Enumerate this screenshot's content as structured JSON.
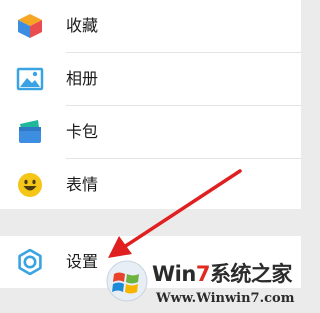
{
  "menu": {
    "items": [
      {
        "label": "收藏",
        "icon": "favorites-cube-icon"
      },
      {
        "label": "相册",
        "icon": "album-picture-icon"
      },
      {
        "label": "卡包",
        "icon": "card-wallet-icon"
      },
      {
        "label": "表情",
        "icon": "emoji-smiley-icon"
      }
    ],
    "settings": {
      "label": "设置",
      "icon": "settings-gear-icon"
    }
  },
  "annotation": {
    "arrow_color": "#e02020",
    "points_to": "设置"
  },
  "watermark": {
    "brand_prefix": "Win",
    "brand_digit": "7",
    "brand_suffix": "系统之家",
    "url": "Www.Winwin7.com"
  },
  "colors": {
    "accent_blue": "#3aa3e3",
    "cube_top": "#f5a623",
    "cube_left": "#3d8ee0",
    "cube_right": "#e94d4d",
    "emoji_yellow": "#f5c518",
    "wallet_green": "#1fb89a",
    "background_gray": "#ebebeb"
  }
}
